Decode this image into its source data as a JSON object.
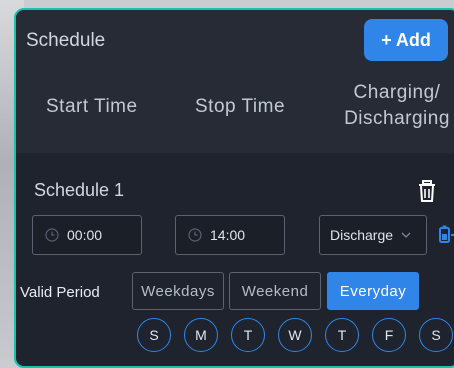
{
  "header": {
    "title": "Schedule",
    "add_button": "+ Add"
  },
  "columns": {
    "start": "Start Time",
    "stop": "Stop Time",
    "mode_line1": "Charging/",
    "mode_line2": "Discharging"
  },
  "schedule": {
    "name": "Schedule 1",
    "start_time": "00:00",
    "stop_time": "14:00",
    "mode": "Discharge",
    "valid_period_label": "Valid Period",
    "periods": [
      "Weekdays",
      "Weekend",
      "Everyday"
    ],
    "selected_period": "Everyday",
    "days": [
      "S",
      "M",
      "T",
      "W",
      "T",
      "F",
      "S"
    ]
  },
  "icons": [
    "clock-icon",
    "chevron-down-icon",
    "trash-icon",
    "battery-icon"
  ],
  "colors": {
    "accent": "#2f86e8",
    "border": "#18c3ad",
    "panel": "#1e232d"
  }
}
